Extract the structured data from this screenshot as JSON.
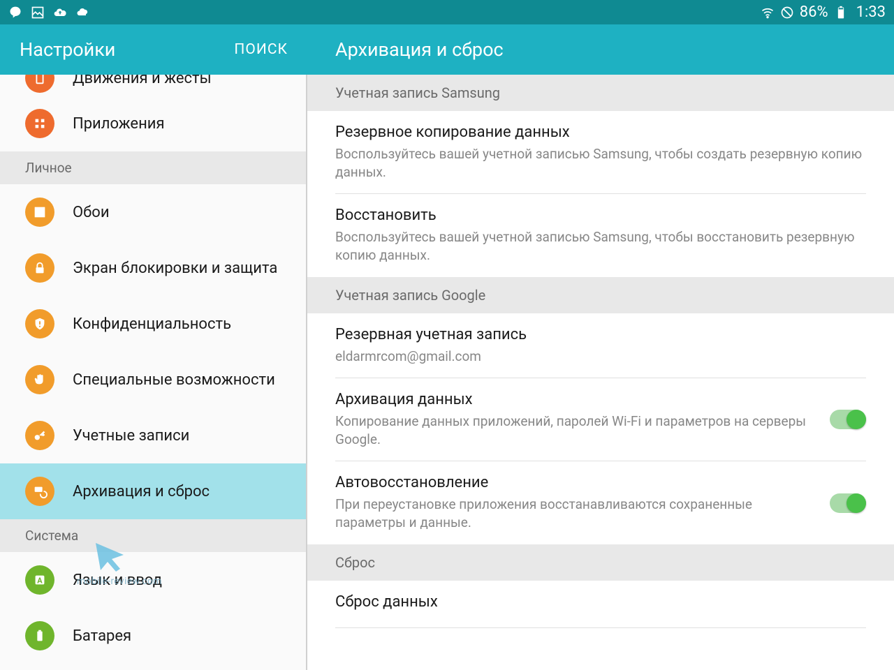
{
  "statusbar": {
    "battery": "86%",
    "time": "1:33"
  },
  "header": {
    "settings_title": "Настройки",
    "search": "ПОИСК",
    "detail_title": "Архивация и сброс"
  },
  "sidebar": {
    "items": [
      {
        "label": "Движения и жесты"
      },
      {
        "label": "Приложения"
      }
    ],
    "section1": "Личное",
    "personal": [
      {
        "label": "Обои"
      },
      {
        "label": "Экран блокировки и защита"
      },
      {
        "label": "Конфиденциальность"
      },
      {
        "label": "Специальные возможности"
      },
      {
        "label": "Учетные записи"
      },
      {
        "label": "Архивация и сброс"
      }
    ],
    "section2": "Система",
    "system": [
      {
        "label": "Язык и ввод"
      },
      {
        "label": "Батарея"
      }
    ]
  },
  "detail": {
    "section_samsung": "Учетная запись Samsung",
    "backup_data": {
      "title": "Резервное копирование данных",
      "sub": "Воспользуйтесь вашей учетной записью Samsung, чтобы создать резервную копию данных."
    },
    "restore": {
      "title": "Восстановить",
      "sub": "Воспользуйтесь вашей учетной записью Samsung, чтобы восстановить резервную копию данных."
    },
    "section_google": "Учетная запись Google",
    "backup_account": {
      "title": "Резервная учетная запись",
      "sub": "eldarmrcom@gmail.com"
    },
    "archive": {
      "title": "Архивация данных",
      "sub": "Копирование данных приложений, паролей Wi-Fi и параметров на серверы Google."
    },
    "autorestore": {
      "title": "Автовосстановление",
      "sub": "При переустановке приложения восстанавливаются сохраненные параметры и данные."
    },
    "section_reset": "Сброс",
    "reset": {
      "title": "Сброс данных"
    }
  },
  "watermark": "mobile-review.com"
}
